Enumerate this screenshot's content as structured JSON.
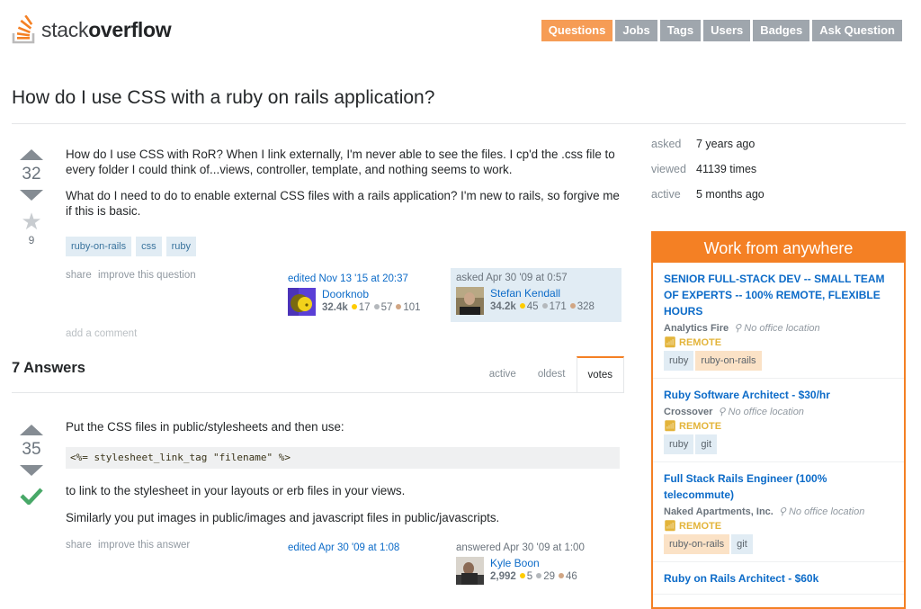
{
  "header": {
    "logo_light": "stack",
    "logo_bold": "overflow",
    "nav": [
      {
        "label": "Questions",
        "active": true
      },
      {
        "label": "Jobs",
        "active": false
      },
      {
        "label": "Tags",
        "active": false
      },
      {
        "label": "Users",
        "active": false
      },
      {
        "label": "Badges",
        "active": false
      },
      {
        "label": "Ask Question",
        "active": false
      }
    ]
  },
  "question": {
    "title": "How do I use CSS with a ruby on rails application?",
    "votes": "32",
    "favorites": "9",
    "body": [
      "How do I use CSS with RoR? When I link externally, I'm never able to see the files. I cp'd the .css file to every folder I could think of...views, controller, template, and nothing seems to work.",
      "What do I need to do to enable external CSS files with a rails application? I'm new to rails, so forgive me if this is basic."
    ],
    "tags": [
      "ruby-on-rails",
      "css",
      "ruby"
    ],
    "menu": {
      "share": "share",
      "improve": "improve this question"
    },
    "editor": {
      "action": "edited Nov 13 '15 at 20:37",
      "name": "Doorknob",
      "rep": "32.4k",
      "gold": "17",
      "silver": "57",
      "bronze": "101"
    },
    "owner": {
      "action": "asked Apr 30 '09 at 0:57",
      "name": "Stefan Kendall",
      "rep": "34.2k",
      "gold": "45",
      "silver": "171",
      "bronze": "328"
    },
    "add_comment": "add a comment"
  },
  "answers_header": {
    "title": "7 Answers",
    "tabs": [
      {
        "label": "active",
        "active": false
      },
      {
        "label": "oldest",
        "active": false
      },
      {
        "label": "votes",
        "active": true
      }
    ]
  },
  "answer": {
    "votes": "35",
    "accepted": true,
    "line1": "Put the CSS files in public/stylesheets and then use:",
    "code": "<%= stylesheet_link_tag \"filename\" %>",
    "line2": "to link to the stylesheet in your layouts or erb files in your views.",
    "line3": "Similarly you put images in public/images and javascript files in public/javascripts.",
    "menu": {
      "share": "share",
      "improve": "improve this answer"
    },
    "editor": {
      "action": "edited Apr 30 '09 at 1:08"
    },
    "owner": {
      "action": "answered Apr 30 '09 at 1:00",
      "name": "Kyle Boon",
      "rep": "2,992",
      "gold": "5",
      "silver": "29",
      "bronze": "46"
    }
  },
  "sidebar": {
    "stats": [
      {
        "label": "asked",
        "value": "7 years ago"
      },
      {
        "label": "viewed",
        "value": "41139 times"
      },
      {
        "label": "active",
        "value": "5 months ago"
      }
    ],
    "jobs": {
      "heading": "Work from anywhere",
      "listings": [
        {
          "title": "SENIOR FULL-STACK DEV -- SMALL TEAM OF EXPERTS -- 100% REMOTE, FLEXIBLE HOURS",
          "company": "Analytics Fire",
          "location": "No office location",
          "remote": "REMOTE",
          "tags": [
            {
              "label": "ruby",
              "highlight": false
            },
            {
              "label": "ruby-on-rails",
              "highlight": true
            }
          ]
        },
        {
          "title": "Ruby Software Architect - $30/hr",
          "company": "Crossover",
          "location": "No office location",
          "remote": "REMOTE",
          "tags": [
            {
              "label": "ruby",
              "highlight": false
            },
            {
              "label": "git",
              "highlight": false
            }
          ]
        },
        {
          "title": "Full Stack Rails Engineer (100% telecommute)",
          "company": "Naked Apartments, Inc.",
          "location": "No office location",
          "remote": "REMOTE",
          "tags": [
            {
              "label": "ruby-on-rails",
              "highlight": true
            },
            {
              "label": "git",
              "highlight": false
            }
          ]
        },
        {
          "title": "Ruby on Rails Architect - $60k"
        }
      ]
    }
  },
  "colors": {
    "brand_orange": "#f48024",
    "active_nav": "#f69c55",
    "nav_grey": "#9fa6ad",
    "link_blue": "#0c6bc8",
    "accept_green": "#48a868"
  }
}
